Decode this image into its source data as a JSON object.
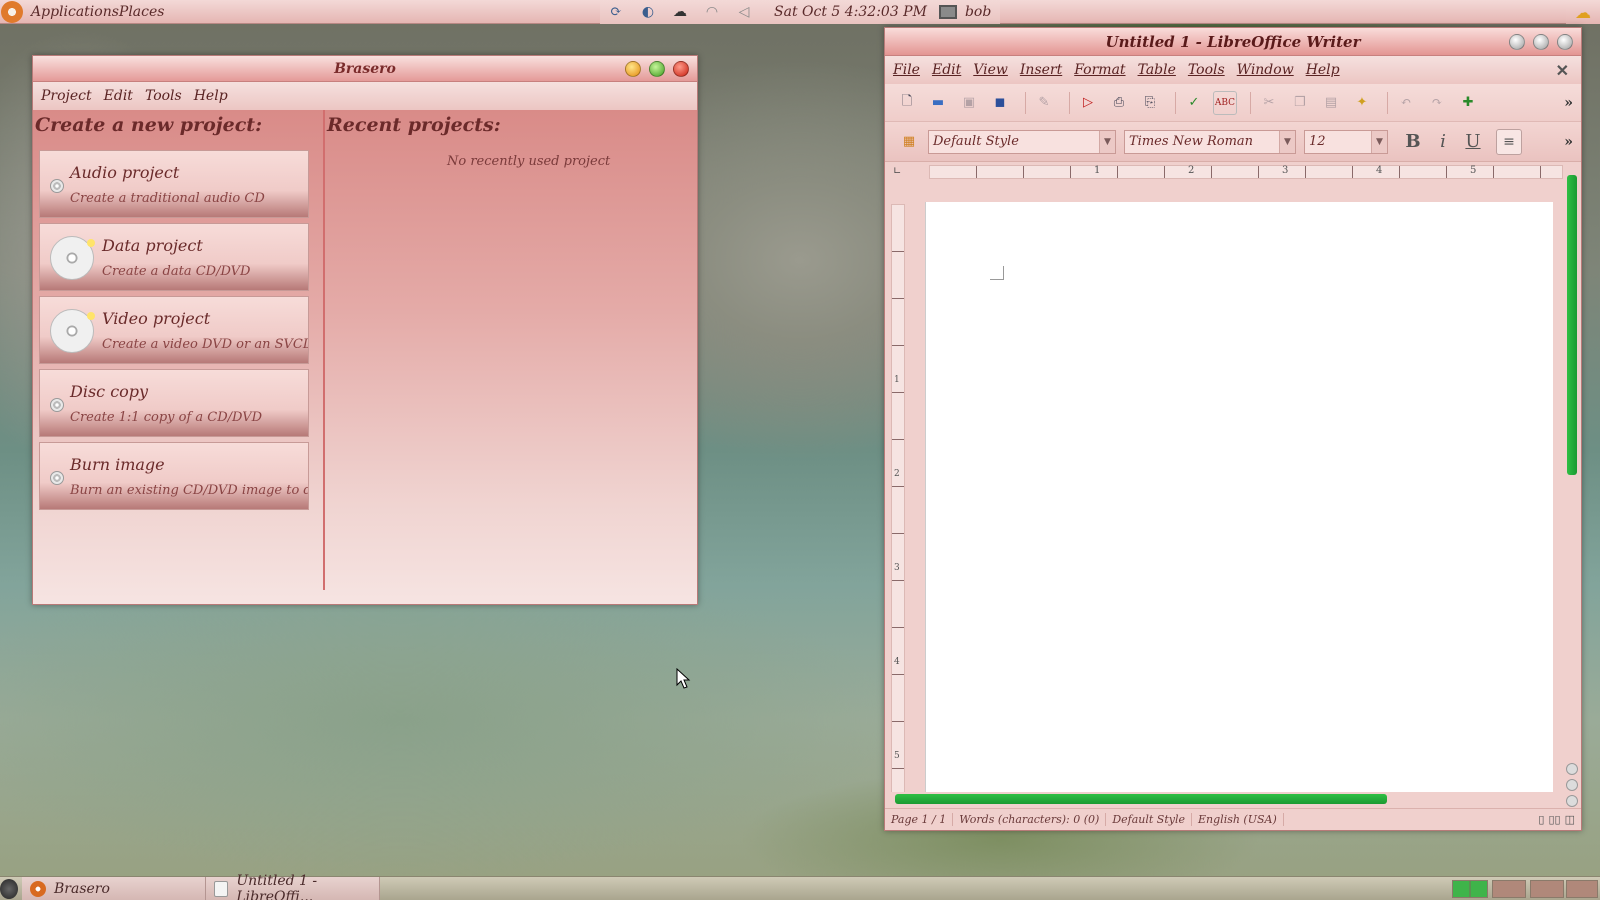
{
  "top_panel": {
    "menu_label": "ApplicationsPlaces",
    "clock": "Sat Oct  5   4:32:03 PM",
    "user": "bob",
    "icons": [
      "ubuntu-logo-icon",
      "update-icon",
      "network-icon",
      "cloud-icon",
      "wifi-icon",
      "volume-icon",
      "monitor-icon",
      "weather-icon"
    ]
  },
  "brasero": {
    "title": "Brasero",
    "menus": [
      "Project",
      "Edit",
      "Tools",
      "Help"
    ],
    "new_heading": "Create a new project:",
    "recent_heading": "Recent projects:",
    "no_recent": "No recently used project",
    "projects": [
      {
        "name": "Audio project",
        "desc": "Create a traditional audio CD",
        "icon": "audio-disc-icon"
      },
      {
        "name": "Data project",
        "desc": "Create a data CD/DVD",
        "icon": "data-disc-icon"
      },
      {
        "name": "Video project",
        "desc": "Create a video DVD or an SVCD",
        "icon": "video-disc-icon"
      },
      {
        "name": "Disc copy",
        "desc": "Create 1:1 copy of a CD/DVD",
        "icon": "disc-copy-icon"
      },
      {
        "name": "Burn image",
        "desc": "Burn an existing CD/DVD image to disc",
        "icon": "burn-image-icon"
      }
    ]
  },
  "writer": {
    "title": "Untitled 1 - LibreOffice Writer",
    "menus": [
      "File",
      "Edit",
      "View",
      "Insert",
      "Format",
      "Table",
      "Tools",
      "Window",
      "Help"
    ],
    "paragraph_style": "Default Style",
    "font_name": "Times New Roman",
    "font_size": "12",
    "status": {
      "page": "Page 1 / 1",
      "words": "Words (characters): 0 (0)",
      "style": "Default Style",
      "language": "English (USA)"
    },
    "ruler_numbers": [
      "1",
      "2",
      "3",
      "4",
      "5"
    ],
    "v_ruler_numbers": [
      "1",
      "2",
      "3",
      "4",
      "5"
    ]
  },
  "taskbar": {
    "items": [
      {
        "label": "Brasero"
      },
      {
        "label": "Untitled 1 - LibreOffi..."
      }
    ]
  }
}
